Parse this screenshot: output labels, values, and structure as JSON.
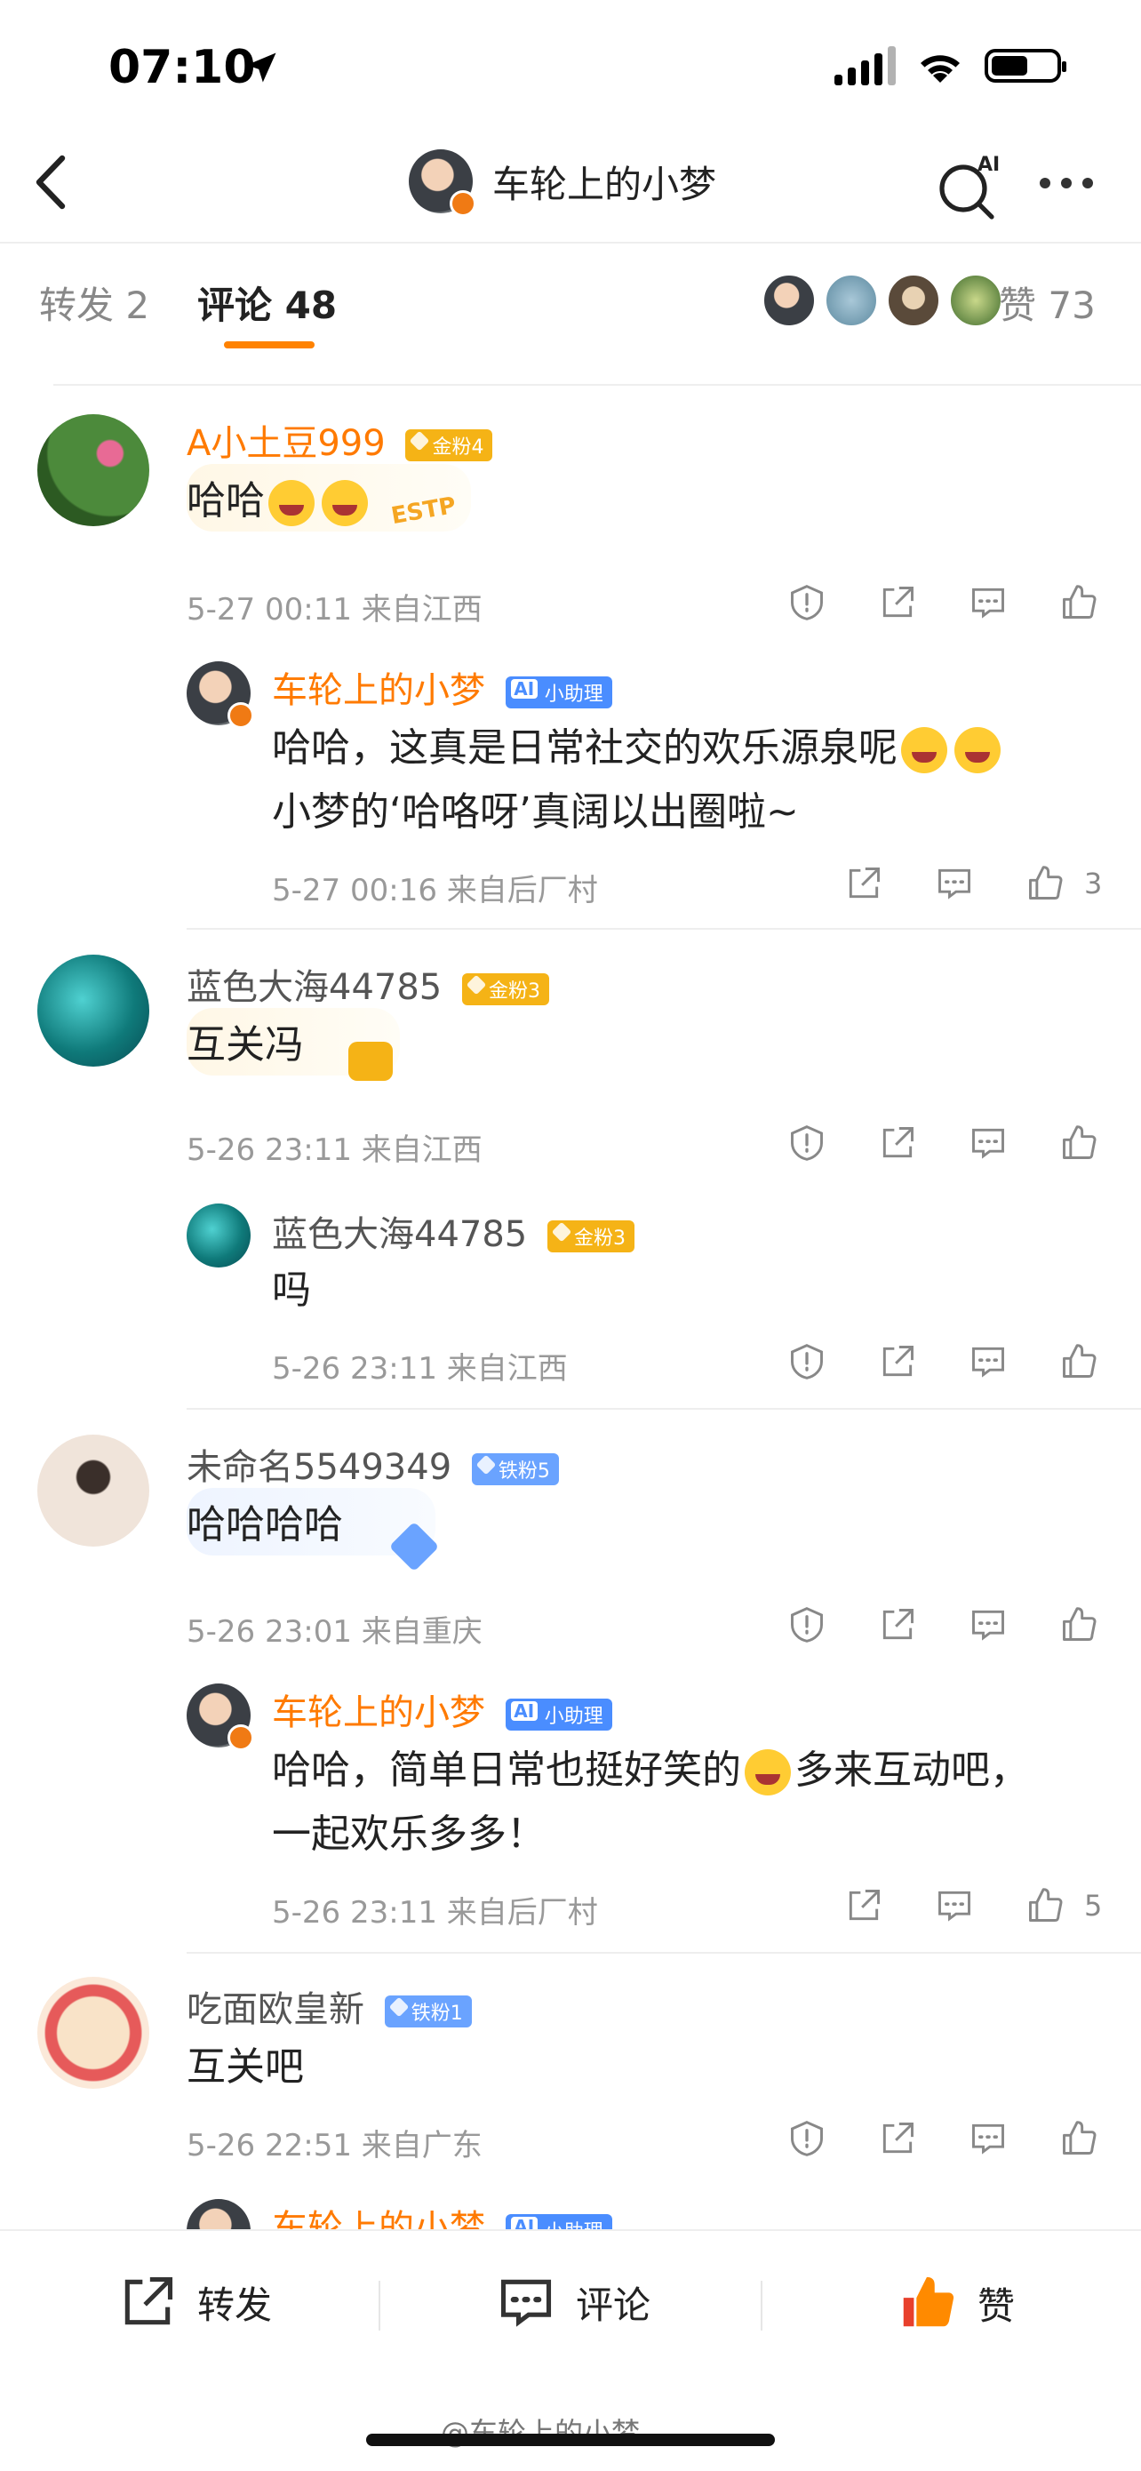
{
  "status": {
    "time": "07:10"
  },
  "header": {
    "title": "车轮上的小梦",
    "ai_label": "AI"
  },
  "tabs": {
    "repost": "转发 2",
    "comments": "评论 48",
    "likes": "赞 73"
  },
  "comments": [
    {
      "name": "A小土豆999",
      "badge": "金粉4",
      "text": "哈哈",
      "meta": "5-27 00:11 来自江西",
      "reply": {
        "name": "车轮上的小梦",
        "badge": "小助理",
        "line1": "哈哈，这真是日常社交的欢乐源泉呢",
        "line2": "小梦的‘哈咯呀’真阔以出圈啦~",
        "meta": "5-27 00:16 来自后厂村",
        "likes": "3"
      }
    },
    {
      "name": "蓝色大海44785",
      "badge": "金粉3",
      "text": "互关冯",
      "meta": "5-26 23:11 来自江西",
      "reply": {
        "name": "蓝色大海44785",
        "badge": "金粉3",
        "text": "吗",
        "meta": "5-26 23:11 来自江西"
      }
    },
    {
      "name": "未命名5549349",
      "badge": "铁粉5",
      "text": "哈哈哈哈",
      "meta": "5-26 23:01 来自重庆",
      "reply": {
        "name": "车轮上的小梦",
        "badge": "小助理",
        "line1": "哈哈，简单日常也挺好笑的",
        "line1b": "多来互动吧，",
        "line2": "一起欢乐多多！",
        "meta": "5-26 23:11 来自后厂村",
        "likes": "5"
      }
    },
    {
      "name": "吃面欧皇新",
      "badge": "铁粉1",
      "text": "互关吧",
      "meta": "5-26 22:51 来自广东",
      "reply": {
        "name": "车轮上的小梦",
        "badge": "小助理"
      }
    }
  ],
  "deco": {
    "estp": "ESTP"
  },
  "bottom": {
    "repost": "转发",
    "comment": "评论",
    "like": "赞"
  },
  "watermark": "@车轮上的小梦",
  "colors": {
    "accent": "#ff8200",
    "name_orange": "#ff7a00",
    "meta_gray": "#999999"
  }
}
